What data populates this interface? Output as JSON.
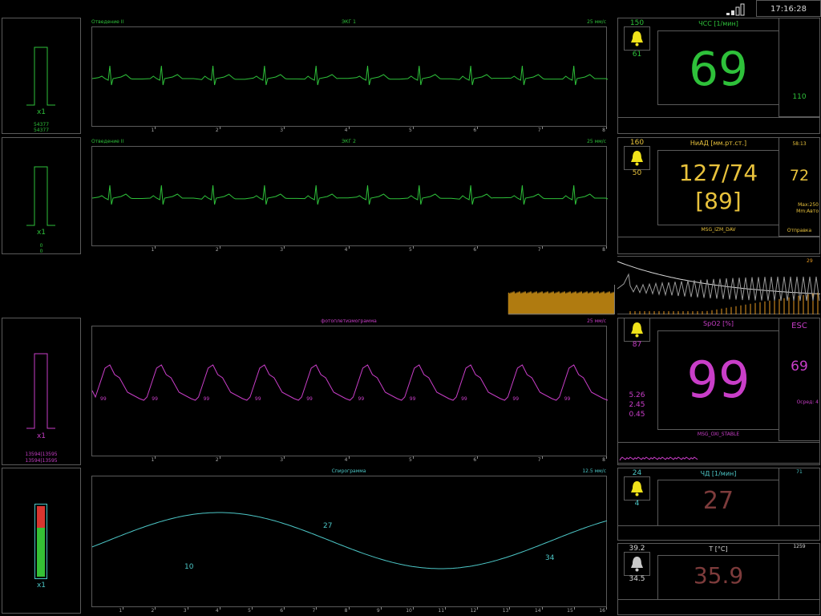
{
  "topbar": {
    "clock": "17:16:28",
    "signal_icon": "signal-strength-icon",
    "battery_icon": "battery-icon"
  },
  "colors": {
    "ecg": "#2ec13a",
    "nibp": "#e8c23c",
    "spo2": "#c93ec8",
    "resp_wave": "#4cc6c6",
    "resp_value": "#7d3b3b",
    "temp_value": "#7d3b3b",
    "border": "#5a5a5a"
  },
  "ecg1": {
    "lead": "Отведение II",
    "title": "ЭКГ 1",
    "speed": "25 мм/с",
    "gain": "x1",
    "num1": "54377",
    "num2": "54377",
    "ticks": [
      "1",
      "2",
      "3",
      "4",
      "5",
      "6",
      "7",
      "8"
    ]
  },
  "ecg2": {
    "lead": "Отведение II",
    "title": "ЭКГ 2",
    "speed": "25 мм/с",
    "gain": "x1",
    "num1": "0",
    "num2": "0",
    "ticks": [
      "1",
      "2",
      "3",
      "4",
      "5",
      "6",
      "7",
      "8"
    ]
  },
  "pleth": {
    "title": "фотоплетизмограмма",
    "speed": "25 мм/с",
    "gain": "x1",
    "num1": "13594|13595",
    "num2": "13594|13595",
    "peak_label": "99",
    "ticks": [
      "1",
      "2",
      "3",
      "4",
      "5",
      "6",
      "7",
      "8"
    ]
  },
  "resp_wave": {
    "title": "Спирограмма",
    "speed": "12.5 мм/с",
    "gain": "x1",
    "labels": [
      "10",
      "27",
      "34"
    ],
    "ticks": [
      "1",
      "2",
      "3",
      "4",
      "5",
      "6",
      "7",
      "8",
      "9",
      "10",
      "11",
      "12",
      "13",
      "14",
      "15",
      "16"
    ]
  },
  "hr": {
    "label": "ЧСС [1/мин]",
    "alarm_high": "150",
    "alarm_low": "61",
    "value": "69",
    "aux": "110"
  },
  "nibp": {
    "label": "НиАД [мм.рт.ст.]",
    "alarm_high": "160",
    "alarm_low": "50",
    "value": "127/74",
    "mean": "[89]",
    "timer": "58:13",
    "pulse": "72",
    "max": "Max:250",
    "mode": "Mm:Авто",
    "msg": "MSG_IZM_DAV",
    "status": "Отправка"
  },
  "nibp_graph": {
    "label": "29"
  },
  "spo2": {
    "label": "SpO2 [%]",
    "alarm_low": "87",
    "value": "99",
    "esc": "ESC",
    "pulse": "69",
    "avg": "Осред: 4",
    "perf": [
      "5.26",
      "2.45",
      "0.45"
    ],
    "msg": "MSG_OXI_STABLE"
  },
  "rr": {
    "label": "ЧД [1/мин]",
    "alarm_high": "24",
    "alarm_low": "4",
    "value": "27",
    "aux": "71"
  },
  "temp": {
    "label": "T [°C]",
    "alarm_high": "39.2",
    "alarm_low": "34.5",
    "value": "35.9",
    "aux": "1259"
  }
}
